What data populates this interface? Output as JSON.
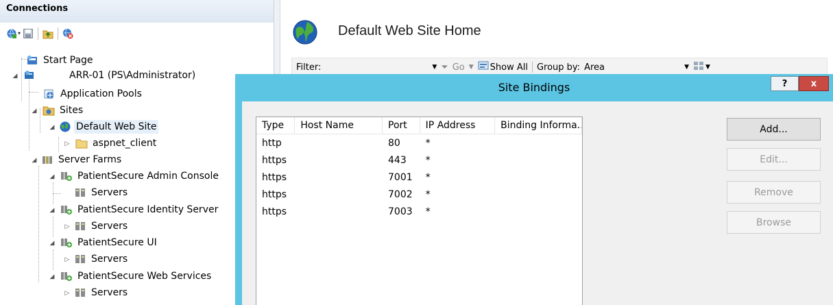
{
  "connections": {
    "title": "Connections",
    "toolbar": [
      "connect-icon",
      "save-icon",
      "up-folder-icon",
      "disconnect-icon"
    ],
    "tree": [
      {
        "label": "Start Page",
        "icon": "start-page-icon"
      },
      {
        "label": "ARR-01 (PS\\Administrator)",
        "icon": "server-icon"
      },
      {
        "label": "Application Pools",
        "icon": "app-pools-icon"
      },
      {
        "label": "Sites",
        "icon": "sites-folder-icon"
      },
      {
        "label": "Default Web Site",
        "icon": "globe-icon"
      },
      {
        "label": "aspnet_client",
        "icon": "folder-icon"
      },
      {
        "label": "Server Farms",
        "icon": "server-farms-icon"
      },
      {
        "label": "PatientSecure Admin Console",
        "icon": "farm-icon"
      },
      {
        "label": "Servers",
        "icon": "servers-icon"
      },
      {
        "label": "PatientSecure Identity Server",
        "icon": "farm-icon"
      },
      {
        "label": "Servers",
        "icon": "servers-icon"
      },
      {
        "label": "PatientSecure UI",
        "icon": "farm-icon"
      },
      {
        "label": "Servers",
        "icon": "servers-icon"
      },
      {
        "label": "PatientSecure Web Services",
        "icon": "farm-icon"
      },
      {
        "label": "Servers",
        "icon": "servers-icon"
      }
    ]
  },
  "home": {
    "title": "Default Web Site Home",
    "filter_label": "Filter:",
    "go_label": "Go",
    "show_all_label": "Show All",
    "group_by_label": "Group by:",
    "group_by_value": "Area"
  },
  "dialog": {
    "title": "Site Bindings",
    "help_label": "?",
    "close_label": "x",
    "columns": [
      "Type",
      "Host Name",
      "Port",
      "IP Address",
      "Binding Informa..."
    ],
    "rows": [
      [
        "http",
        "",
        "80",
        "*",
        ""
      ],
      [
        "https",
        "",
        "443",
        "*",
        ""
      ],
      [
        "https",
        "",
        "7001",
        "*",
        ""
      ],
      [
        "https",
        "",
        "7002",
        "*",
        ""
      ],
      [
        "https",
        "",
        "7003",
        "*",
        ""
      ]
    ],
    "buttons": {
      "add": "Add...",
      "edit": "Edit...",
      "remove": "Remove",
      "browse": "Browse"
    }
  },
  "colors": {
    "dialog_frame": "#5bc5e3",
    "close_button": "#c84a43",
    "selection": "#e6f0fa"
  }
}
